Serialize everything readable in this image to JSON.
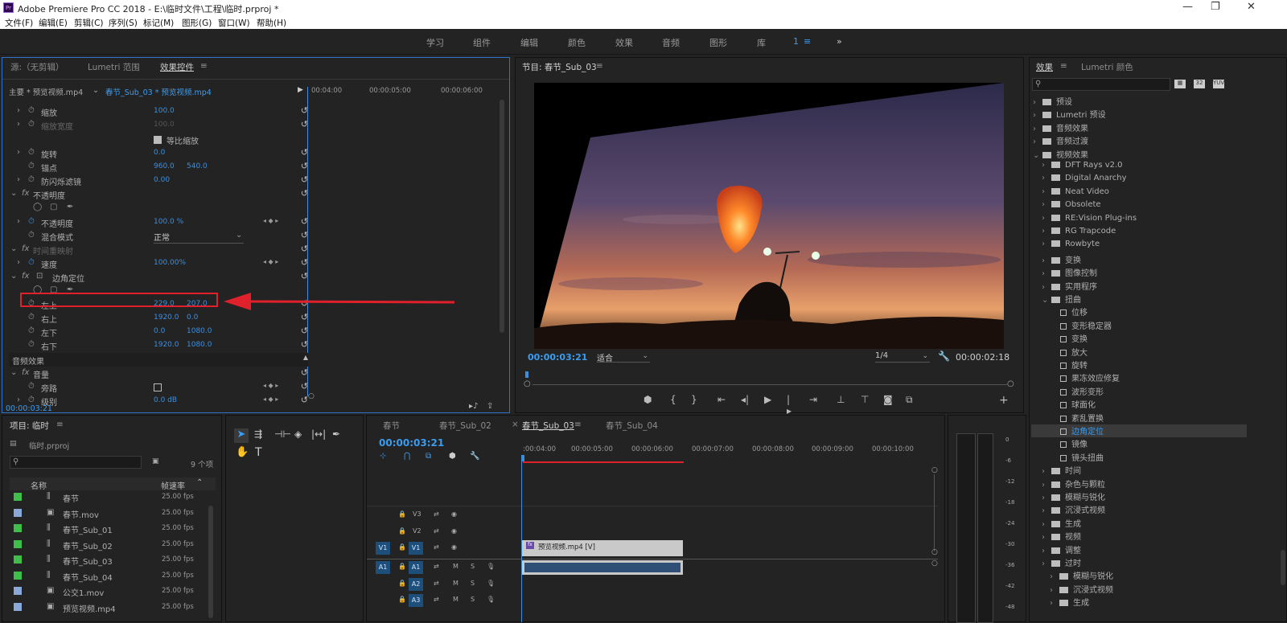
{
  "app": {
    "title": "Adobe Premiere Pro CC 2018 - E:\\临时文件\\工程\\临时.prproj *",
    "logo": "Pr"
  },
  "window": {
    "minimize": "—",
    "restore": "❐",
    "close": "✕"
  },
  "menu": [
    "文件(F)",
    "编辑(E)",
    "剪辑(C)",
    "序列(S)",
    "标记(M)",
    "图形(G)",
    "窗口(W)",
    "帮助(H)"
  ],
  "workspaces": [
    "学习",
    "组件",
    "编辑",
    "颜色",
    "效果",
    "音频",
    "图形",
    "库",
    "1",
    "≡",
    "»"
  ],
  "effect_controls": {
    "tabs": [
      "源:（无剪辑）",
      "Lumetri 范围",
      "效果控件",
      "≡"
    ],
    "master": "主要 * 预览视频.mp4",
    "clip": "春节_Sub_03 * 预览视频.mp4",
    "ruler": [
      "00:04:00",
      "00:00:05:00",
      "00:00:06:00"
    ],
    "rows": [
      {
        "label": "缩放",
        "v1": "100.0",
        "v2": ""
      },
      {
        "label": "缩放宽度",
        "v1": "100.0",
        "v2": ""
      },
      {
        "label": "等比缩放",
        "v1": "",
        "v2": ""
      },
      {
        "label": "旋转",
        "v1": "0.0",
        "v2": ""
      },
      {
        "label": "锚点",
        "v1": "960.0",
        "v2": "540.0"
      },
      {
        "label": "防闪烁滤镜",
        "v1": "0.00",
        "v2": ""
      },
      {
        "label": "不透明度",
        "v1": "",
        "v2": ""
      },
      {
        "label": "",
        "v1": "",
        "v2": ""
      },
      {
        "label": "不透明度",
        "v1": "100.0 %",
        "v2": ""
      },
      {
        "label": "混合模式",
        "v1": "正常",
        "v2": ""
      },
      {
        "label": "时间重映射",
        "v1": "",
        "v2": ""
      },
      {
        "label": "速度",
        "v1": "100.00%",
        "v2": ""
      },
      {
        "label": "边角定位",
        "v1": "",
        "v2": ""
      },
      {
        "label": "",
        "v1": "",
        "v2": ""
      },
      {
        "label": "左上",
        "v1": "229.0",
        "v2": "207.0"
      },
      {
        "label": "右上",
        "v1": "1920.0",
        "v2": "0.0"
      },
      {
        "label": "左下",
        "v1": "0.0",
        "v2": "1080.0"
      },
      {
        "label": "右下",
        "v1": "1920.0",
        "v2": "1080.0"
      },
      {
        "label": "音频效果",
        "v1": "",
        "v2": ""
      },
      {
        "label": "音量",
        "v1": "",
        "v2": ""
      },
      {
        "label": "旁路",
        "v1": "",
        "v2": ""
      },
      {
        "label": "级别",
        "v1": "0.0 dB",
        "v2": ""
      }
    ],
    "timecode": "00:00:03:21"
  },
  "program": {
    "title": "节目: 春节_Sub_03",
    "menu": "≡",
    "timecode": "00:00:03:21",
    "fit": "适合",
    "resolution": "1/4",
    "duration": "00:00:02:18"
  },
  "effects_panel": {
    "tabs": [
      "效果",
      "≡",
      "Lumetri 颜色"
    ],
    "items": [
      {
        "d": 0,
        "t": "预设",
        "open": false,
        "kind": "folder"
      },
      {
        "d": 0,
        "t": "Lumetri 预设",
        "open": false,
        "kind": "folder"
      },
      {
        "d": 0,
        "t": "音频效果",
        "open": false,
        "kind": "folder"
      },
      {
        "d": 0,
        "t": "音频过渡",
        "open": false,
        "kind": "folder"
      },
      {
        "d": 0,
        "t": "视频效果",
        "open": true,
        "kind": "folder"
      },
      {
        "d": 1,
        "t": "DFT Rays v2.0",
        "open": false,
        "kind": "folder"
      },
      {
        "d": 1,
        "t": "Digital Anarchy",
        "open": false,
        "kind": "folder"
      },
      {
        "d": 1,
        "t": "Neat Video",
        "open": false,
        "kind": "folder"
      },
      {
        "d": 1,
        "t": "Obsolete",
        "open": false,
        "kind": "folder"
      },
      {
        "d": 1,
        "t": "RE:Vision Plug-ins",
        "open": false,
        "kind": "folder"
      },
      {
        "d": 1,
        "t": "RG Trapcode",
        "open": false,
        "kind": "folder"
      },
      {
        "d": 1,
        "t": "Rowbyte",
        "open": false,
        "kind": "folder"
      },
      {
        "d": 1,
        "t": "变换",
        "open": false,
        "kind": "folder"
      },
      {
        "d": 1,
        "t": "图像控制",
        "open": false,
        "kind": "folder"
      },
      {
        "d": 1,
        "t": "实用程序",
        "open": false,
        "kind": "folder"
      },
      {
        "d": 1,
        "t": "扭曲",
        "open": true,
        "kind": "folder"
      },
      {
        "d": 2,
        "t": "位移",
        "kind": "fx"
      },
      {
        "d": 2,
        "t": "变形稳定器",
        "kind": "fx"
      },
      {
        "d": 2,
        "t": "变换",
        "kind": "fx"
      },
      {
        "d": 2,
        "t": "放大",
        "kind": "fx"
      },
      {
        "d": 2,
        "t": "旋转",
        "kind": "fx"
      },
      {
        "d": 2,
        "t": "果冻效应修复",
        "kind": "fx"
      },
      {
        "d": 2,
        "t": "波形变形",
        "kind": "fx"
      },
      {
        "d": 2,
        "t": "球面化",
        "kind": "fx"
      },
      {
        "d": 2,
        "t": "紊乱置换",
        "kind": "fx"
      },
      {
        "d": 2,
        "t": "边角定位",
        "kind": "fx",
        "selected": true
      },
      {
        "d": 2,
        "t": "镜像",
        "kind": "fx"
      },
      {
        "d": 2,
        "t": "镜头扭曲",
        "kind": "fx"
      },
      {
        "d": 1,
        "t": "时间",
        "open": false,
        "kind": "folder"
      },
      {
        "d": 1,
        "t": "杂色与颗粒",
        "open": false,
        "kind": "folder"
      },
      {
        "d": 1,
        "t": "模糊与锐化",
        "open": false,
        "kind": "folder"
      },
      {
        "d": 1,
        "t": "沉浸式视频",
        "open": false,
        "kind": "folder"
      },
      {
        "d": 1,
        "t": "生成",
        "open": false,
        "kind": "folder"
      },
      {
        "d": 1,
        "t": "视频",
        "open": false,
        "kind": "folder"
      },
      {
        "d": 1,
        "t": "调整",
        "open": false,
        "kind": "folder"
      },
      {
        "d": 1,
        "t": "过时",
        "open": false,
        "kind": "folder"
      },
      {
        "d": 1,
        "t": "模糊与锐化",
        "open": false,
        "kind": "folder"
      },
      {
        "d": 1,
        "t": "沉浸式视频",
        "open": false,
        "kind": "folder"
      },
      {
        "d": 1,
        "t": "生成",
        "open": false,
        "kind": "folder"
      }
    ]
  },
  "project": {
    "title": "项目: 临时",
    "menu": "≡",
    "file": "临时.prproj",
    "count": "9 个项",
    "col_name": "名称",
    "col_fps": "帧速率",
    "items": [
      {
        "name": "春节",
        "fps": "25.00 fps",
        "color": "#3fbf4a",
        "kind": "seq"
      },
      {
        "name": "春节.mov",
        "fps": "25.00 fps",
        "color": "#8aa8d8",
        "kind": "clip"
      },
      {
        "name": "春节_Sub_01",
        "fps": "25.00 fps",
        "color": "#3fbf4a",
        "kind": "seq"
      },
      {
        "name": "春节_Sub_02",
        "fps": "25.00 fps",
        "color": "#3fbf4a",
        "kind": "seq"
      },
      {
        "name": "春节_Sub_03",
        "fps": "25.00 fps",
        "color": "#3fbf4a",
        "kind": "seq"
      },
      {
        "name": "春节_Sub_04",
        "fps": "25.00 fps",
        "color": "#3fbf4a",
        "kind": "seq"
      },
      {
        "name": "公交1.mov",
        "fps": "25.00 fps",
        "color": "#8aa8d8",
        "kind": "clip"
      },
      {
        "name": "预览视频.mp4",
        "fps": "25.00 fps",
        "color": "#8aa8d8",
        "kind": "clip"
      }
    ]
  },
  "timeline": {
    "tabs": [
      "春节",
      "春节_Sub_02",
      "×",
      "春节_Sub_03",
      "≡",
      "春节_Sub_04"
    ],
    "timecode": "00:00:03:21",
    "ruler": [
      ":00:04:00",
      "00:00:05:00",
      "00:00:06:00",
      "00:00:07:00",
      "00:00:08:00",
      "00:00:09:00",
      "00:00:10:00"
    ],
    "tracks": {
      "V3": "V3",
      "V2": "V2",
      "V1": "V1",
      "A1": "A1",
      "A2": "A2",
      "A3": "A3",
      "M": "M",
      "S": "S"
    },
    "clip": "预览视频.mp4 [V]"
  },
  "meter": [
    "0",
    "-6",
    "-12",
    "-18",
    "-24",
    "-30",
    "-36",
    "-42",
    "-48",
    "-18",
    "-24"
  ]
}
